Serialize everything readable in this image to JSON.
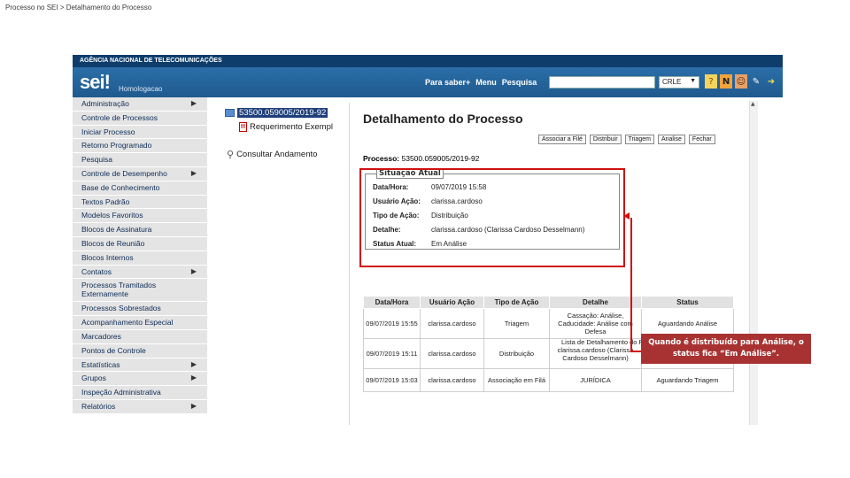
{
  "slide": {
    "caption": "Processo no SEI > Detalhamento do Processo"
  },
  "app": {
    "agency": "AGÊNCIA NACIONAL DE TELECOMUNICAÇÕES",
    "logo": "sei!",
    "environment": "Homologacao",
    "nav_links": [
      "Para saber+",
      "Menu",
      "Pesquisa"
    ],
    "search_value": "",
    "unit_selected": "CRLE",
    "header_icons": [
      "help-icon",
      "notes-icon",
      "user-icon",
      "tools-icon",
      "exit-icon"
    ]
  },
  "sidebar": {
    "items": [
      {
        "label": "Administração",
        "submenu": true
      },
      {
        "label": "Controle de Processos",
        "submenu": false
      },
      {
        "label": "Iniciar Processo",
        "submenu": false
      },
      {
        "label": "Retorno Programado",
        "submenu": false
      },
      {
        "label": "Pesquisa",
        "submenu": false
      },
      {
        "label": "Controle de Desempenho",
        "submenu": true
      },
      {
        "label": "Base de Conhecimento",
        "submenu": false
      },
      {
        "label": "Textos Padrão",
        "submenu": false
      },
      {
        "label": "Modelos Favoritos",
        "submenu": false
      },
      {
        "label": "Blocos de Assinatura",
        "submenu": false
      },
      {
        "label": "Blocos de Reunião",
        "submenu": false
      },
      {
        "label": "Blocos Internos",
        "submenu": false
      },
      {
        "label": "Contatos",
        "submenu": true
      },
      {
        "label": "Processos Tramitados Externamente",
        "submenu": false,
        "two_lines": true
      },
      {
        "label": "Processos Sobrestados",
        "submenu": false
      },
      {
        "label": "Acompanhamento Especial",
        "submenu": false
      },
      {
        "label": "Marcadores",
        "submenu": false
      },
      {
        "label": "Pontos de Controle",
        "submenu": false
      },
      {
        "label": "Estatísticas",
        "submenu": true
      },
      {
        "label": "Grupos",
        "submenu": true
      },
      {
        "label": "Inspeção Administrativa",
        "submenu": false
      },
      {
        "label": "Relatórios",
        "submenu": true
      }
    ]
  },
  "tree": {
    "process_number": "53500.059005/2019-92",
    "document": "Requerimento Exempl",
    "consult": "Consultar Andamento"
  },
  "main": {
    "title": "Detalhamento do Processo",
    "actions": [
      "Associar a Filé",
      "Distribuir",
      "Triagem",
      "Analise",
      "Fechar"
    ],
    "process_label": "Processo:",
    "process_value": "53500.059005/2019-92",
    "status_legend": "Situação Atual",
    "status_fields": [
      {
        "label": "Data/Hora:",
        "value": "09/07/2019 15:58"
      },
      {
        "label": "Usuário Ação:",
        "value": "clarissa.cardoso"
      },
      {
        "label": "Tipo de Ação:",
        "value": "Distribuição"
      },
      {
        "label": "Detalhe:",
        "value": "clarissa.cardoso (Clarissa Cardoso Desselmann)"
      },
      {
        "label": "Status Atual:",
        "value": "Em Análise"
      }
    ],
    "table_caption": "Lista de Detalhamento do Processo (3 registros):",
    "table": {
      "headers": [
        "Data/Hora",
        "Usuário Ação",
        "Tipo de Ação",
        "Detalhe",
        "Status"
      ],
      "rows": [
        [
          "09/07/2019 15:55",
          "clarissa.cardoso",
          "Triagem",
          "Cassação: Análise, Caducidade: Análise com Defesa",
          "Aguardando Análise"
        ],
        [
          "09/07/2019 15:11",
          "clarissa.cardoso",
          "Distribuição",
          "clarissa.cardoso (Clarissa Cardoso Desselmann)",
          ""
        ],
        [
          "09/07/2019 15:03",
          "clarissa.cardoso",
          "Associação em Filá",
          "JURÍDICA",
          "Aguardando Triagem"
        ]
      ]
    }
  },
  "callout": {
    "text": "Quando é distribuído para Análise, o status fica “Em Análise”."
  }
}
